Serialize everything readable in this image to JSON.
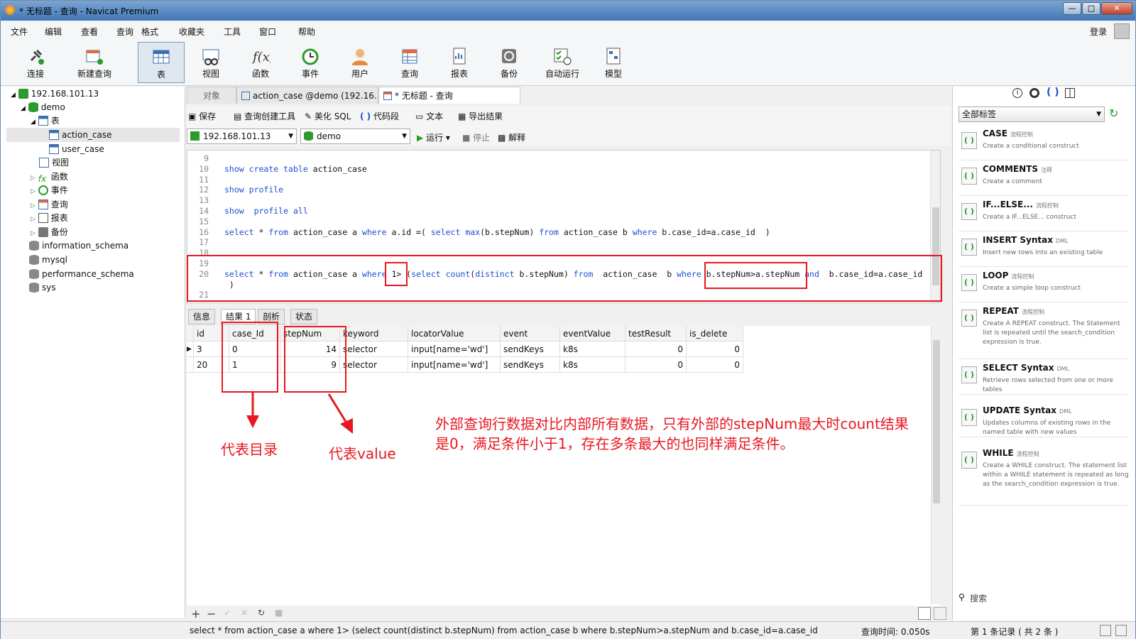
{
  "window": {
    "title": "* 无标题 - 查询 - Navicat Premium",
    "login": "登录"
  },
  "menu": [
    "文件",
    "编辑",
    "查看",
    "查询",
    "格式",
    "收藏夹",
    "工具",
    "窗口",
    "帮助"
  ],
  "toolbar": [
    {
      "label": "连接",
      "icon": "plug-icon"
    },
    {
      "label": "新建查询",
      "icon": "new-query-icon"
    },
    {
      "label": "表",
      "icon": "table-icon"
    },
    {
      "label": "视图",
      "icon": "view-icon"
    },
    {
      "label": "函数",
      "icon": "function-icon"
    },
    {
      "label": "事件",
      "icon": "clock-icon"
    },
    {
      "label": "用户",
      "icon": "user-icon"
    },
    {
      "label": "查询",
      "icon": "query-icon"
    },
    {
      "label": "报表",
      "icon": "report-icon"
    },
    {
      "label": "备份",
      "icon": "backup-icon"
    },
    {
      "label": "自动运行",
      "icon": "autorun-icon"
    },
    {
      "label": "模型",
      "icon": "model-icon"
    }
  ],
  "tree": {
    "connection": "192.168.101.13",
    "db": "demo",
    "tables_label": "表",
    "tables": [
      "action_case",
      "user_case"
    ],
    "groups": [
      "视图",
      "函数",
      "事件",
      "查询",
      "报表",
      "备份"
    ],
    "other_dbs": [
      "information_schema",
      "mysql",
      "performance_schema",
      "sys"
    ]
  },
  "tabs": [
    "对象",
    "action_case @demo (192.16...",
    "* 无标题 - 查询"
  ],
  "query_tools": {
    "save": "保存",
    "builder": "查询创建工具",
    "beautify": "美化 SQL",
    "snippet": "代码段",
    "text": "文本",
    "export": "导出结果",
    "conn": "192.168.101.13",
    "db": "demo",
    "run": "运行",
    "stop": "停止",
    "explain": "解释"
  },
  "editor_lines": [
    {
      "n": "9",
      "code": ""
    },
    {
      "n": "10",
      "code": "show create table action_case"
    },
    {
      "n": "11",
      "code": ""
    },
    {
      "n": "12",
      "code": "show profile"
    },
    {
      "n": "13",
      "code": ""
    },
    {
      "n": "14",
      "code": "show  profile all"
    },
    {
      "n": "15",
      "code": ""
    },
    {
      "n": "16",
      "code": "select * from action_case a where a.id =( select max(b.stepNum) from action_case b where b.case_id=a.case_id  )"
    },
    {
      "n": "17",
      "code": ""
    },
    {
      "n": "18",
      "code": ""
    },
    {
      "n": "19",
      "code": ""
    },
    {
      "n": "20",
      "code": "select * from action_case a where 1> (select count(distinct b.stepNum) from  action_case  b where b.stepNum>a.stepNum and  b.case_id=a.case_id"
    },
    {
      "n": "",
      "code": " )"
    },
    {
      "n": "21",
      "code": ""
    }
  ],
  "result_tabs": [
    "信息",
    "结果 1",
    "剖析",
    "状态"
  ],
  "columns": [
    "id",
    "case_Id",
    "stepNum",
    "keyword",
    "locatorValue",
    "event",
    "eventValue",
    "testResult",
    "is_delete"
  ],
  "rows": [
    {
      "id": "3",
      "case_Id": "0",
      "stepNum": "14",
      "keyword": "selector",
      "locatorValue": "input[name='wd']",
      "event": "sendKeys",
      "eventValue": "k8s",
      "testResult": "0",
      "is_delete": "0"
    },
    {
      "id": "20",
      "case_Id": "1",
      "stepNum": "9",
      "keyword": "selector",
      "locatorValue": "input[name='wd']",
      "event": "sendKeys",
      "eventValue": "k8s",
      "testResult": "0",
      "is_delete": "0"
    }
  ],
  "annotations": {
    "catalog": "代表目录",
    "value": "代表value",
    "note1": "外部查询行数据对比内部所有数据，只有外部的stepNum最大时count结果",
    "note2": "是0，满足条件小于1，存在多条最大的也同样满足条件。"
  },
  "status": {
    "sql": "select * from action_case a where 1> (select count(distinct b.stepNum) from  action_case  b where b.stepNum>a.stepNum and  b.case_id=a.case_id",
    "time": "查询时间: 0.050s",
    "records": "第 1 条记录 ( 共 2 条 )"
  },
  "right_panel": {
    "filter": "全部标签",
    "search": "搜索",
    "snippets": [
      {
        "title": "CASE",
        "tag": "流程控制",
        "desc": "Create a conditional construct"
      },
      {
        "title": "COMMENTS",
        "tag": "注释",
        "desc": "Create a comment"
      },
      {
        "title": "IF...ELSE...",
        "tag": "流程控制",
        "desc": "Create a IF...ELSE... construct"
      },
      {
        "title": "INSERT Syntax",
        "tag": "DML",
        "desc": "Insert new rows into an existing table"
      },
      {
        "title": "LOOP",
        "tag": "流程控制",
        "desc": "Create a simple loop construct"
      },
      {
        "title": "REPEAT",
        "tag": "流程控制",
        "desc": "Create A REPEAT construct. The Statement list is repeated until the search_condition expression is true."
      },
      {
        "title": "SELECT Syntax",
        "tag": "DML",
        "desc": "Retrieve rows selected from one or more tables"
      },
      {
        "title": "UPDATE Syntax",
        "tag": "DML",
        "desc": "Updates columns of existing rows in the named table with new values"
      },
      {
        "title": "WHILE",
        "tag": "流程控制",
        "desc": "Create a WHILE construct. The statement list within a WHILE statement is repeated as long as the search_condition expression is true."
      }
    ]
  },
  "colors": {
    "accent": "#1f4fd1",
    "annotation": "#e8171f",
    "ok": "#2c9a2c"
  }
}
